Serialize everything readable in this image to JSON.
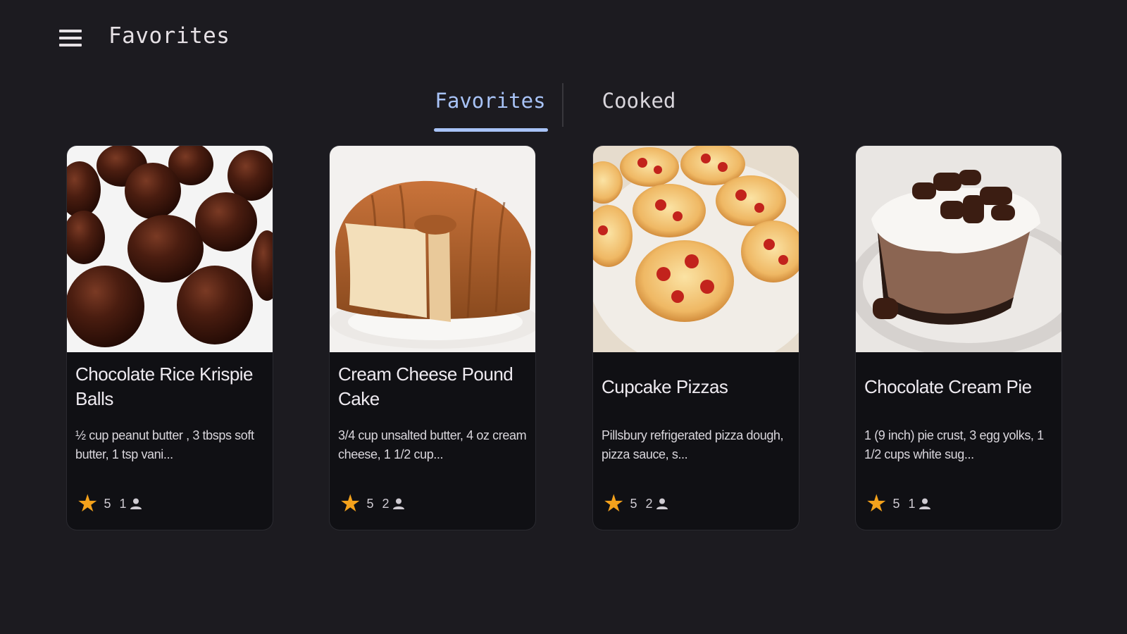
{
  "app_bar": {
    "title": "Favorites",
    "menu_icon": "hamburger-menu-icon"
  },
  "tabs": [
    {
      "label": "Favorites",
      "selected": true
    },
    {
      "label": "Cooked",
      "selected": false
    }
  ],
  "colors": {
    "background": "#1c1b20",
    "card": "#101014",
    "accent": "#a8c3f7",
    "star": "#f4a21c"
  },
  "recipes": [
    {
      "title": "Chocolate Rice Krispie Balls",
      "description": "½ cup peanut butter , 3 tbsps soft butter, 1 tsp vani...",
      "rating": "5",
      "reviews": "1",
      "image": "chocolate-balls-photo"
    },
    {
      "title": "Cream Cheese Pound Cake",
      "description": "3/4 cup unsalted butter, 4 oz cream cheese, 1 1/2 cup...",
      "rating": "5",
      "reviews": "2",
      "image": "bundt-cake-photo"
    },
    {
      "title": "Cupcake Pizzas",
      "description": "Pillsbury refrigerated pizza dough, pizza sauce, s...",
      "rating": "5",
      "reviews": "2",
      "image": "pizza-cupcakes-photo"
    },
    {
      "title": "Chocolate Cream Pie",
      "description": "1 (9 inch) pie crust, 3 egg yolks, 1 1/2 cups white sug...",
      "rating": "5",
      "reviews": "1",
      "image": "cream-pie-photo"
    }
  ]
}
